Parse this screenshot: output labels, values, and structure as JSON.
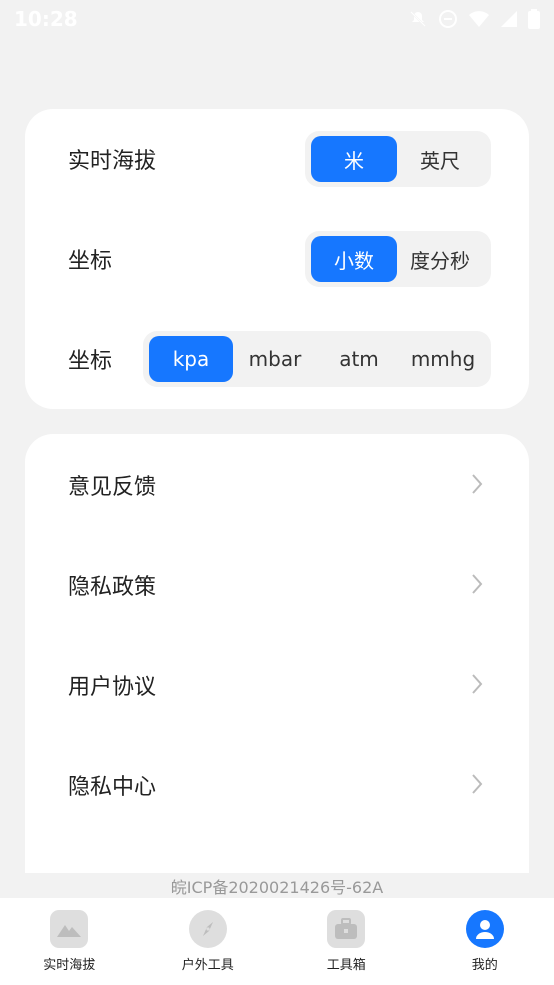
{
  "status_bar": {
    "time": "10:28"
  },
  "settings": {
    "altitude": {
      "label": "实时海拔",
      "options": [
        "米",
        "英尺"
      ],
      "selected": "米"
    },
    "coord": {
      "label": "坐标",
      "options": [
        "小数",
        "度分秒"
      ],
      "selected": "小数"
    },
    "pressure": {
      "label": "坐标",
      "options": [
        "kpa",
        "mbar",
        "atm",
        "mmhg"
      ],
      "selected": "kpa"
    }
  },
  "menu": {
    "items": [
      {
        "label": "意见反馈"
      },
      {
        "label": "隐私政策"
      },
      {
        "label": "用户协议"
      },
      {
        "label": "隐私中心"
      }
    ]
  },
  "footer": {
    "icp": "皖ICP备2020021426号-62A"
  },
  "tabbar": {
    "tabs": [
      {
        "label": "实时海拔",
        "icon": "mountain-icon"
      },
      {
        "label": "户外工具",
        "icon": "compass-icon"
      },
      {
        "label": "工具箱",
        "icon": "toolbox-icon"
      },
      {
        "label": "我的",
        "icon": "user-icon"
      }
    ],
    "active": "我的"
  },
  "colors": {
    "accent": "#1677ff",
    "background": "#f2f2f2",
    "card": "#ffffff"
  }
}
